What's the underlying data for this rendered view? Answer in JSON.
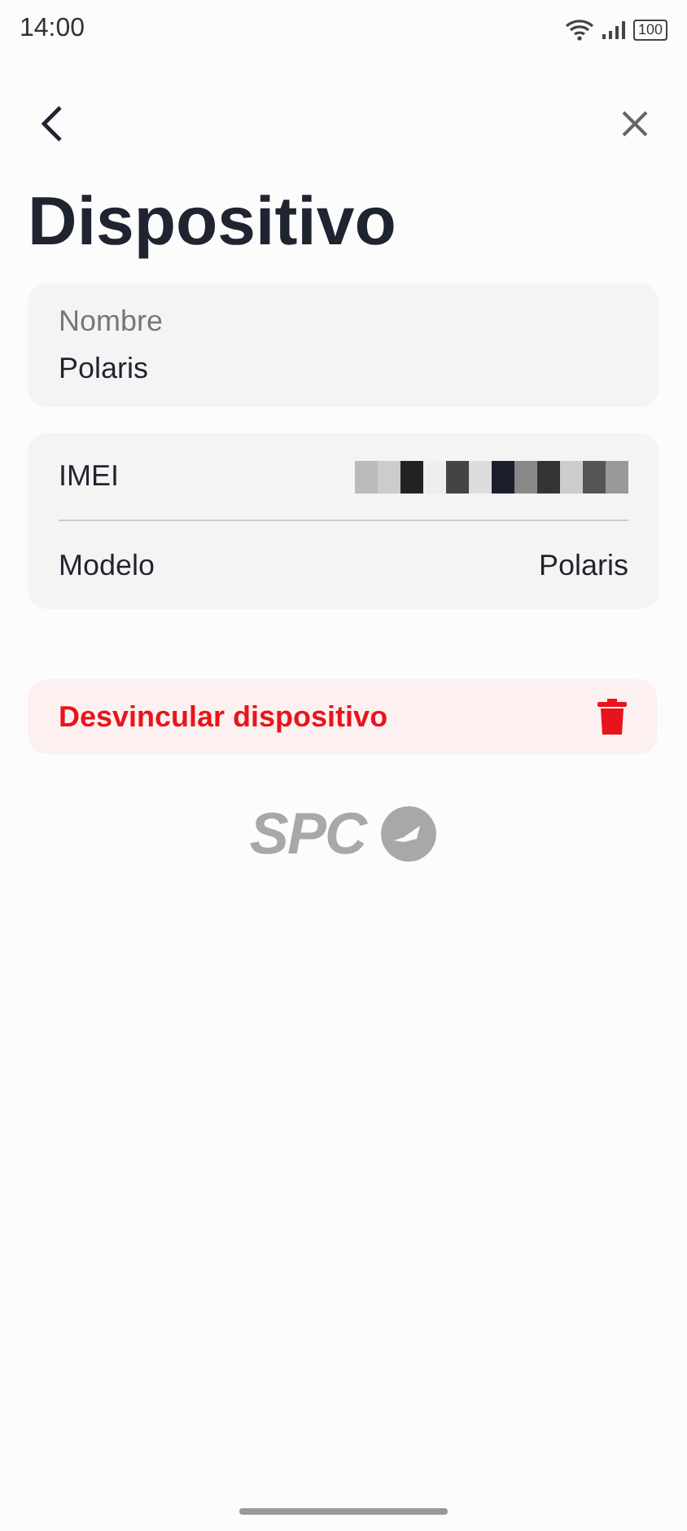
{
  "status_bar": {
    "time": "14:00",
    "battery": "100"
  },
  "title": "Dispositivo",
  "name_field": {
    "label": "Nombre",
    "value": "Polaris"
  },
  "details": [
    {
      "label": "IMEI",
      "kind": "redacted"
    },
    {
      "label": "Modelo",
      "kind": "text",
      "value": "Polaris"
    }
  ],
  "unlink_button": {
    "label": "Desvincular dispositivo"
  },
  "logo": {
    "text": "SPC"
  }
}
